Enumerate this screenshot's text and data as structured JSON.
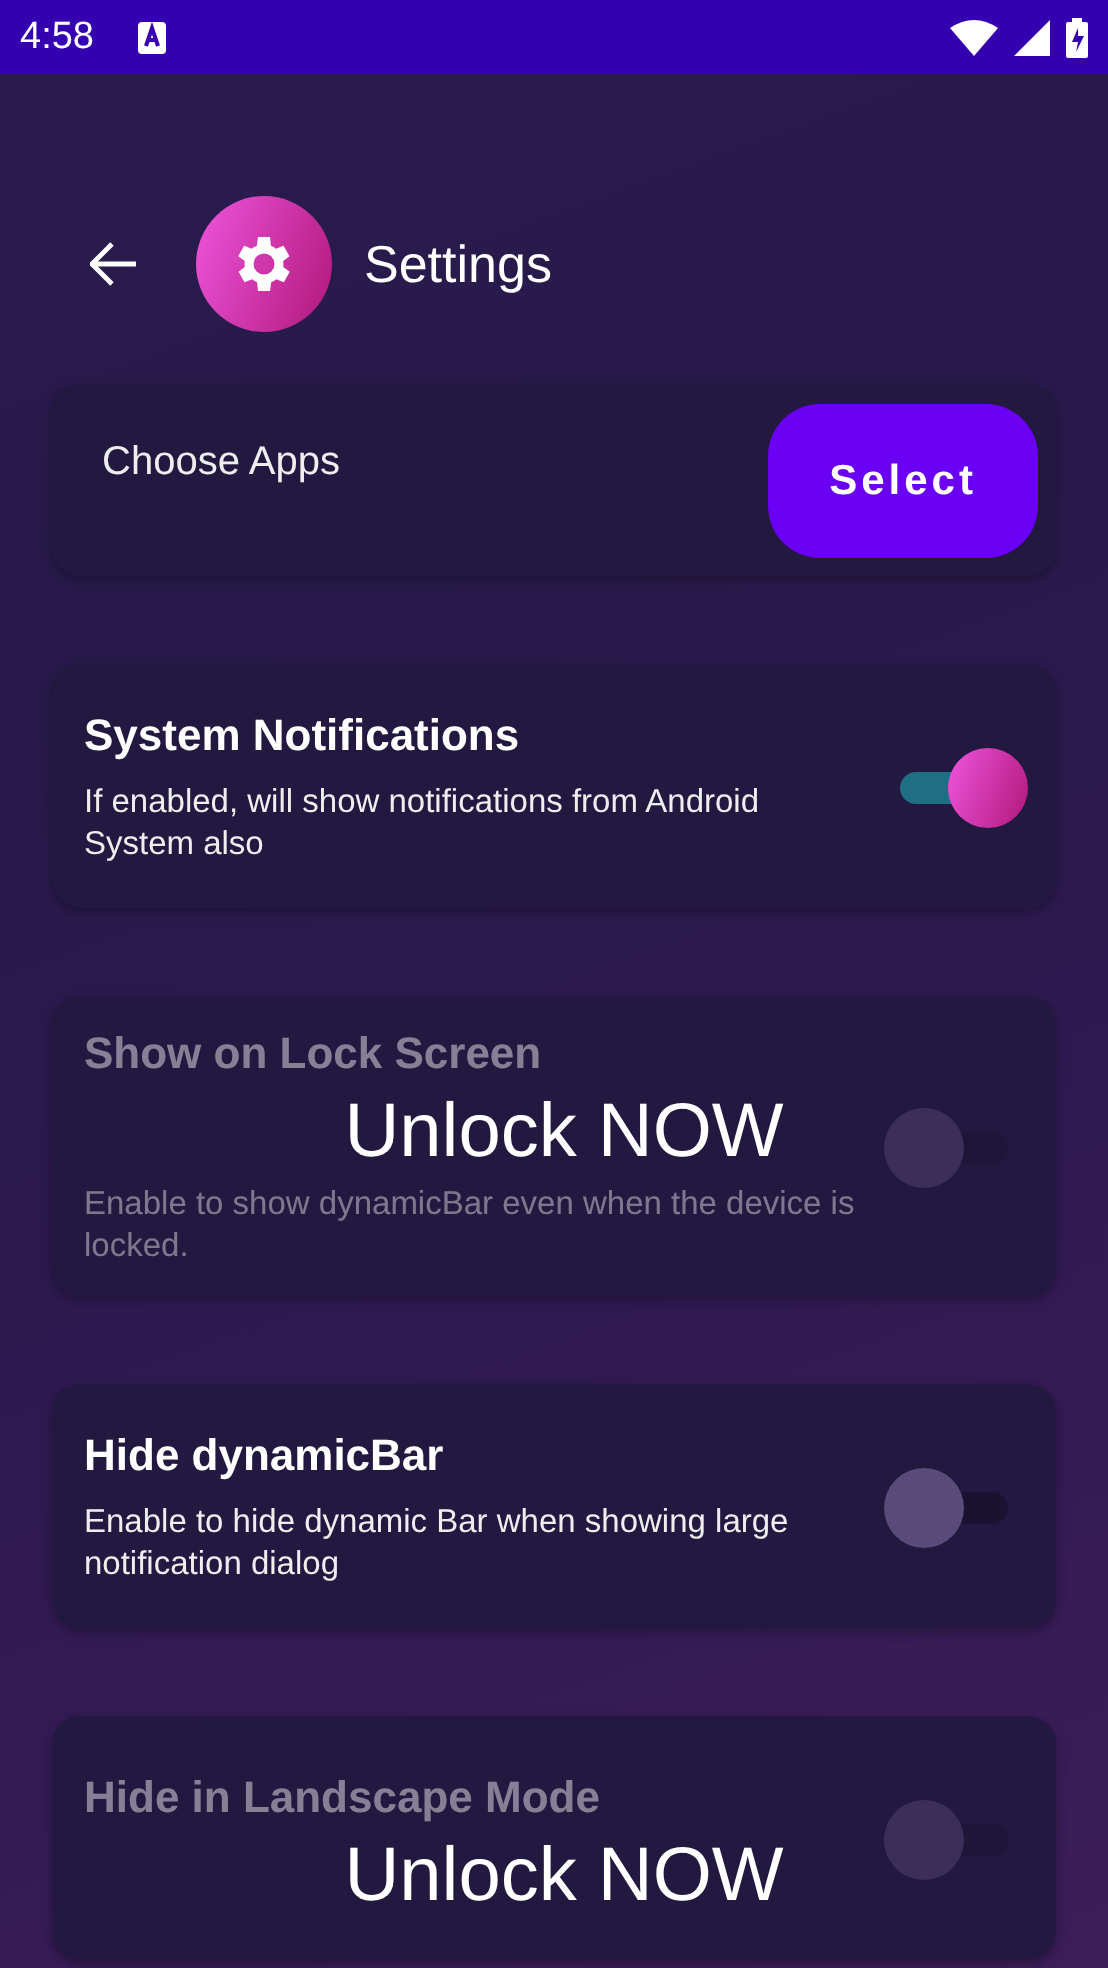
{
  "status_bar": {
    "time": "4:58"
  },
  "header": {
    "title": "Settings"
  },
  "cards": [
    {
      "kind": "select",
      "label": "Choose Apps",
      "button": "Select"
    },
    {
      "kind": "toggle",
      "title": "System Notifications",
      "description": "If enabled, will show notifications from Android System also",
      "on": true,
      "locked": false
    },
    {
      "kind": "toggle",
      "title": "Show on Lock Screen",
      "description": "Enable to show dynamicBar even when the device is locked.",
      "on": false,
      "locked": true,
      "overlay": "Unlock NOW"
    },
    {
      "kind": "toggle",
      "title": "Hide dynamicBar",
      "description": "Enable to hide dynamic Bar when showing large notification dialog",
      "on": false,
      "locked": false
    },
    {
      "kind": "toggle",
      "title": "Hide in Landscape Mode",
      "on": false,
      "locked": true,
      "overlay": "Unlock NOW"
    }
  ]
}
